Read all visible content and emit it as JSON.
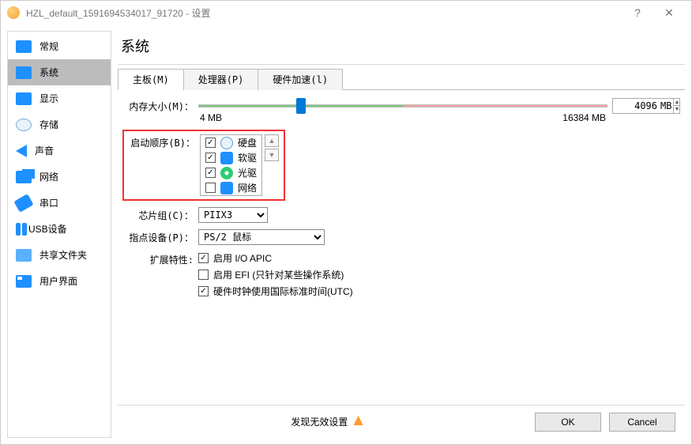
{
  "window": {
    "title": "HZL_default_1591694534017_91720 - 设置"
  },
  "sidebar": {
    "items": [
      {
        "label": "常规"
      },
      {
        "label": "系统"
      },
      {
        "label": "显示"
      },
      {
        "label": "存储"
      },
      {
        "label": "声音"
      },
      {
        "label": "网络"
      },
      {
        "label": "串口"
      },
      {
        "label": "USB设备"
      },
      {
        "label": "共享文件夹"
      },
      {
        "label": "用户界面"
      }
    ]
  },
  "page": {
    "heading": "系统"
  },
  "tabs": [
    {
      "label": "主板(M)"
    },
    {
      "label": "处理器(P)"
    },
    {
      "label": "硬件加速(l)"
    }
  ],
  "memory": {
    "label": "内存大小(M)：",
    "value": "4096",
    "unit": "MB",
    "min_label": "4 MB",
    "max_label": "16384 MB"
  },
  "boot": {
    "label": "启动顺序(B)：",
    "items": [
      {
        "checked": true,
        "icon": "hdd",
        "label": "硬盘"
      },
      {
        "checked": true,
        "icon": "floppy",
        "label": "软驱"
      },
      {
        "checked": true,
        "icon": "cd",
        "label": "光驱"
      },
      {
        "checked": false,
        "icon": "netb",
        "label": "网络"
      }
    ]
  },
  "chipset": {
    "label": "芯片组(C)：",
    "value": "PIIX3"
  },
  "pointing": {
    "label": "指点设备(P)：",
    "value": "PS/2 鼠标"
  },
  "extended": {
    "label": "扩展特性:",
    "items": [
      {
        "checked": true,
        "label": "启用 I/O APIC"
      },
      {
        "checked": false,
        "label": "启用 EFI (只针对某些操作系统)"
      },
      {
        "checked": true,
        "label": "硬件时钟使用国际标准时间(UTC)"
      }
    ]
  },
  "footer": {
    "status": "发现无效设置",
    "ok": "OK",
    "cancel": "Cancel"
  }
}
